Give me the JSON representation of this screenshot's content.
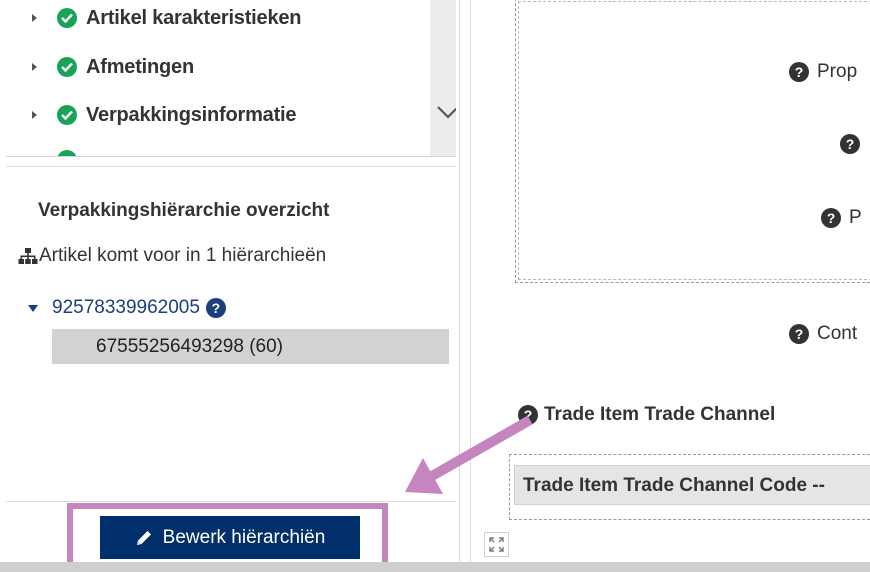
{
  "colors": {
    "success_green": "#19a35a",
    "link_blue": "#1b3f7a",
    "button_navy": "#002f6c",
    "annotation_purple": "#c586c0"
  },
  "sections": {
    "items": [
      {
        "label": "Artikel karakteristieken",
        "status": "complete",
        "icon": "check-circle-icon"
      },
      {
        "label": "Afmetingen",
        "status": "complete",
        "icon": "check-circle-icon"
      },
      {
        "label": "Verpakkingsinformatie",
        "status": "complete",
        "icon": "check-circle-icon"
      }
    ]
  },
  "hierarchy": {
    "title": "Verpakkingshiërarchie overzicht",
    "count_text": "Artikel komt voor in 1 hiërarchieën",
    "root": {
      "gtin": "92578339962005",
      "expanded": true
    },
    "child": {
      "label": "67555256493298 (60)"
    },
    "edit_button_label": "Bewerk hiërarchiën"
  },
  "details": {
    "fields": [
      {
        "label": "Prop"
      },
      {
        "label": ""
      },
      {
        "label": "P"
      },
      {
        "label": "Cont"
      }
    ],
    "trade_channel": {
      "title": "Trade Item Trade Channel",
      "header_label": "Trade Item Trade Channel Code --"
    }
  }
}
